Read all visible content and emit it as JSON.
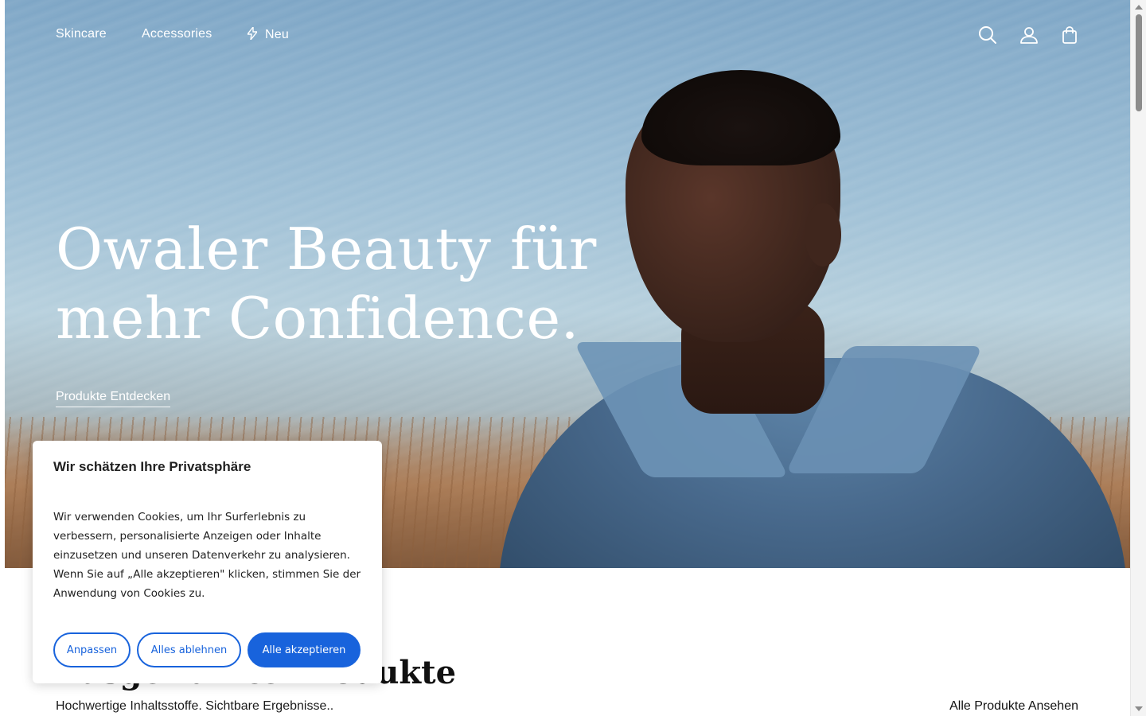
{
  "nav": {
    "links": [
      "Skincare",
      "Accessories",
      "Neu"
    ],
    "new_icon": "bolt-icon",
    "icons": [
      "search-icon",
      "account-icon",
      "shopping-bag-icon"
    ]
  },
  "hero": {
    "title_line1": "Owaler Beauty für",
    "title_line2": "mehr Confidence.",
    "cta": "Produkte Entdecken"
  },
  "section": {
    "title": "Ausgewählte Produkte",
    "subtitle": "Hochwertige Inhaltsstoffe. Sichtbare Ergebnisse..",
    "link": "Alle Produkte Ansehen"
  },
  "cookie": {
    "title": "Wir schätzen Ihre Privatsphäre",
    "text": "Wir verwenden Cookies, um Ihr Surferlebnis zu verbessern, personalisierte Anzeigen oder Inhalte einzusetzen und unseren Datenverkehr zu analysieren. Wenn Sie auf „Alle akzeptieren\" klicken, stimmen Sie der Anwendung von Cookies zu.",
    "customize": "Anpassen",
    "reject": "Alles ablehnen",
    "accept": "Alle akzeptieren",
    "accent": "#1863dc"
  }
}
